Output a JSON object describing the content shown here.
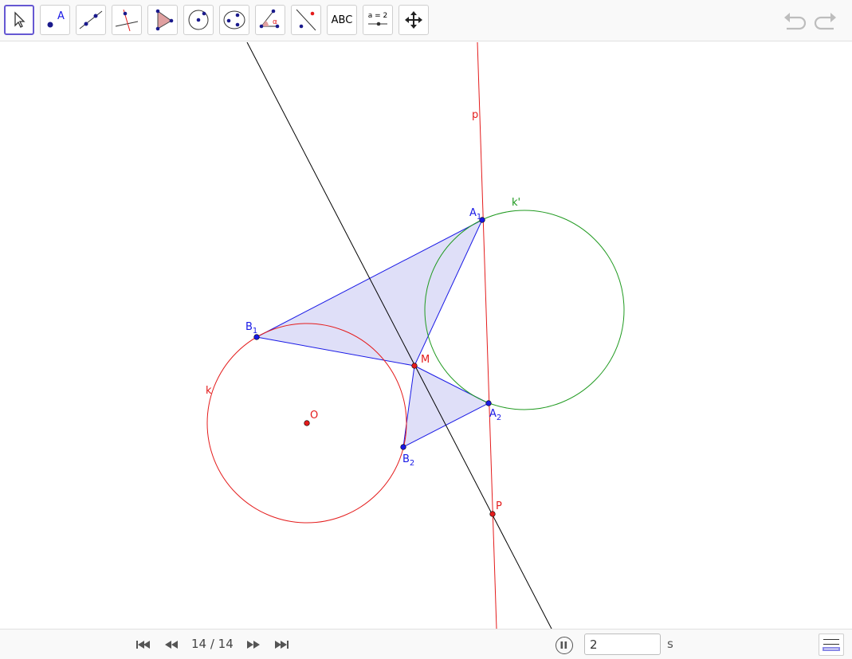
{
  "toolbar": {
    "tools": [
      {
        "name": "move-tool"
      },
      {
        "name": "point-tool",
        "label": "A"
      },
      {
        "name": "line-tool"
      },
      {
        "name": "perpendicular-line-tool"
      },
      {
        "name": "polygon-tool"
      },
      {
        "name": "circle-center-point-tool"
      },
      {
        "name": "conic-tool"
      },
      {
        "name": "angle-tool",
        "label": "α"
      },
      {
        "name": "reflect-tool"
      },
      {
        "name": "text-tool",
        "label": "ABC"
      },
      {
        "name": "slider-tool",
        "label": "a = 2"
      },
      {
        "name": "move-graphics-view-tool"
      }
    ],
    "undo_icon": "undo-icon",
    "redo_icon": "redo-icon"
  },
  "graphics": {
    "colors": {
      "red": "#e41c1c",
      "blue": "#1919e6",
      "green": "#209a20",
      "black": "#000000",
      "fill": "#dcdcf7"
    },
    "labels": {
      "p": "p",
      "k_prime": "k'",
      "k": "k",
      "A1_main": "A",
      "A1_sub": "1",
      "A2_main": "A",
      "A2_sub": "2",
      "B1_main": "B",
      "B1_sub": "1",
      "B2_main": "B",
      "B2_sub": "2",
      "M": "M",
      "O": "O",
      "P": "P"
    }
  },
  "bottombar": {
    "step_counter": "14 / 14",
    "speed_value": "2",
    "speed_unit": "s",
    "nav_icons": [
      "first-step-icon",
      "previous-step-icon",
      "next-step-icon",
      "last-step-icon"
    ],
    "pause_icon": "pause-icon",
    "algebra_icon": "algebra-view-icon"
  }
}
